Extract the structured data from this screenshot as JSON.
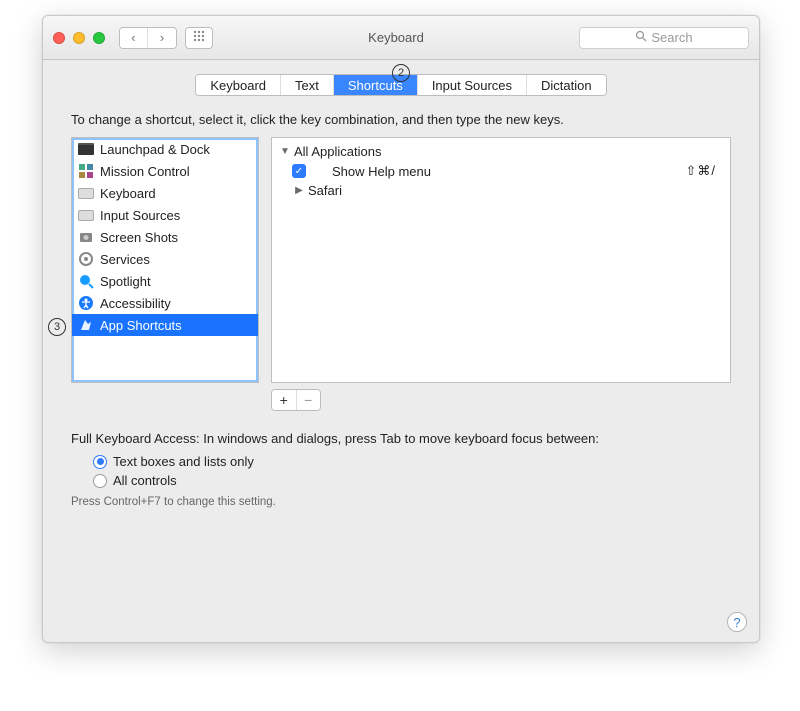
{
  "window": {
    "title": "Keyboard"
  },
  "toolbar": {
    "search_placeholder": "Search"
  },
  "tabs": {
    "items": [
      "Keyboard",
      "Text",
      "Shortcuts",
      "Input Sources",
      "Dictation"
    ],
    "active_index": 2
  },
  "hint": "To change a shortcut, select it, click the key combination, and then type the new keys.",
  "categories": [
    {
      "label": "Launchpad & Dock",
      "icon": "launchpad"
    },
    {
      "label": "Mission Control",
      "icon": "mission-control"
    },
    {
      "label": "Keyboard",
      "icon": "keyboard"
    },
    {
      "label": "Input Sources",
      "icon": "input-sources"
    },
    {
      "label": "Screen Shots",
      "icon": "screenshots"
    },
    {
      "label": "Services",
      "icon": "services"
    },
    {
      "label": "Spotlight",
      "icon": "spotlight"
    },
    {
      "label": "Accessibility",
      "icon": "accessibility"
    },
    {
      "label": "App Shortcuts",
      "icon": "app-shortcuts",
      "selected": true
    }
  ],
  "tree": {
    "root_label": "All Applications",
    "root_expanded": true,
    "items": [
      {
        "label": "Show Help menu",
        "checked": true,
        "shortcut": "⇧⌘/"
      },
      {
        "label": "Safari",
        "expandable": true,
        "expanded": false
      }
    ]
  },
  "addremove": {
    "add": "+",
    "remove": "−"
  },
  "bottom": {
    "label": "Full Keyboard Access: In windows and dialogs, press Tab to move keyboard focus between:",
    "options": [
      "Text boxes and lists only",
      "All controls"
    ],
    "selected_index": 0,
    "footnote": "Press Control+F7 to change this setting."
  },
  "annotations": {
    "step2": "2",
    "step3": "3"
  },
  "help": "?"
}
